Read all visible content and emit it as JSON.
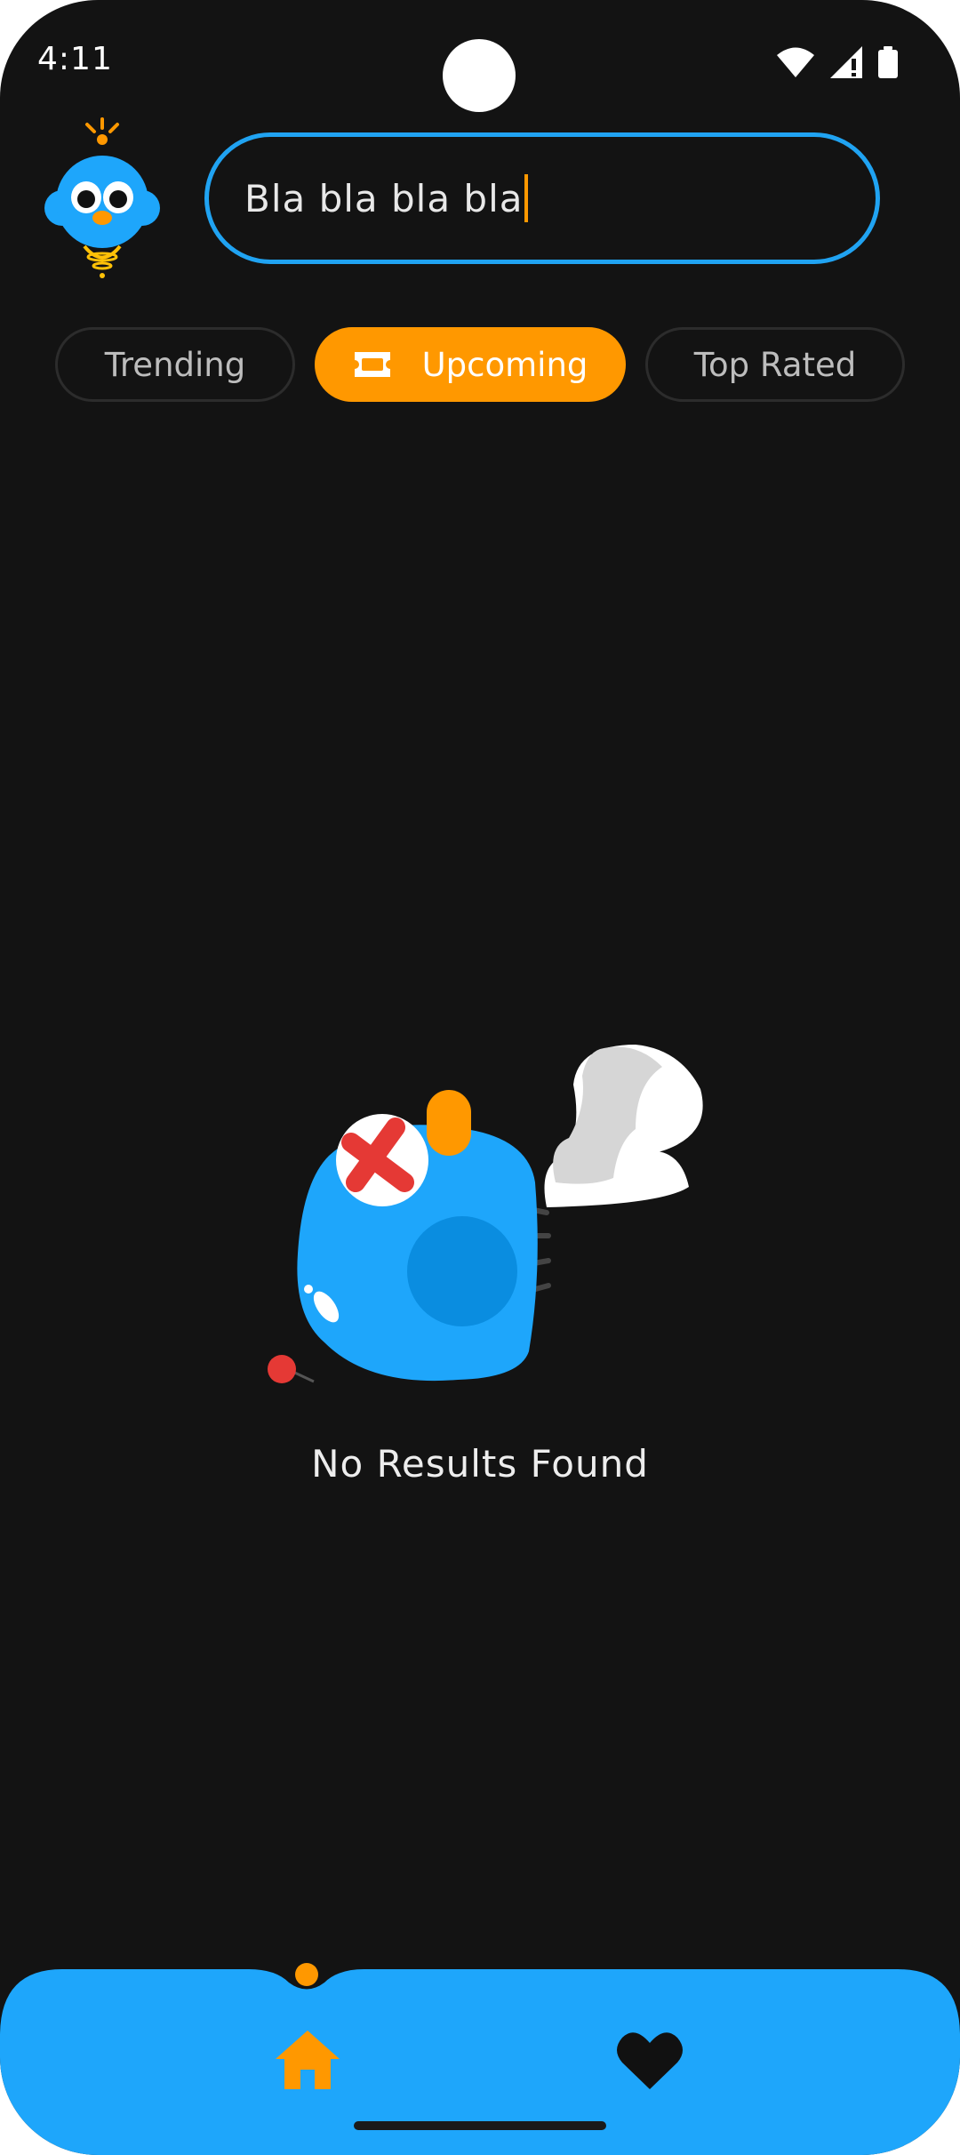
{
  "status_bar": {
    "time": "4:11"
  },
  "search": {
    "value": "Bla bla bla bla"
  },
  "chips": [
    {
      "label": "Trending",
      "active": false
    },
    {
      "label": "Upcoming",
      "active": true,
      "icon": "ticket-icon"
    },
    {
      "label": "Top Rated",
      "active": false
    }
  ],
  "empty_state": {
    "message": "No Results Found"
  },
  "bottom_nav": {
    "items": [
      {
        "icon": "home-icon",
        "active": true
      },
      {
        "icon": "heart-icon",
        "active": false
      }
    ]
  },
  "colors": {
    "background": "#131313",
    "accent_blue": "#20A3F2",
    "accent_orange": "#FF9800",
    "nav_bar": "#1EA6FB"
  }
}
